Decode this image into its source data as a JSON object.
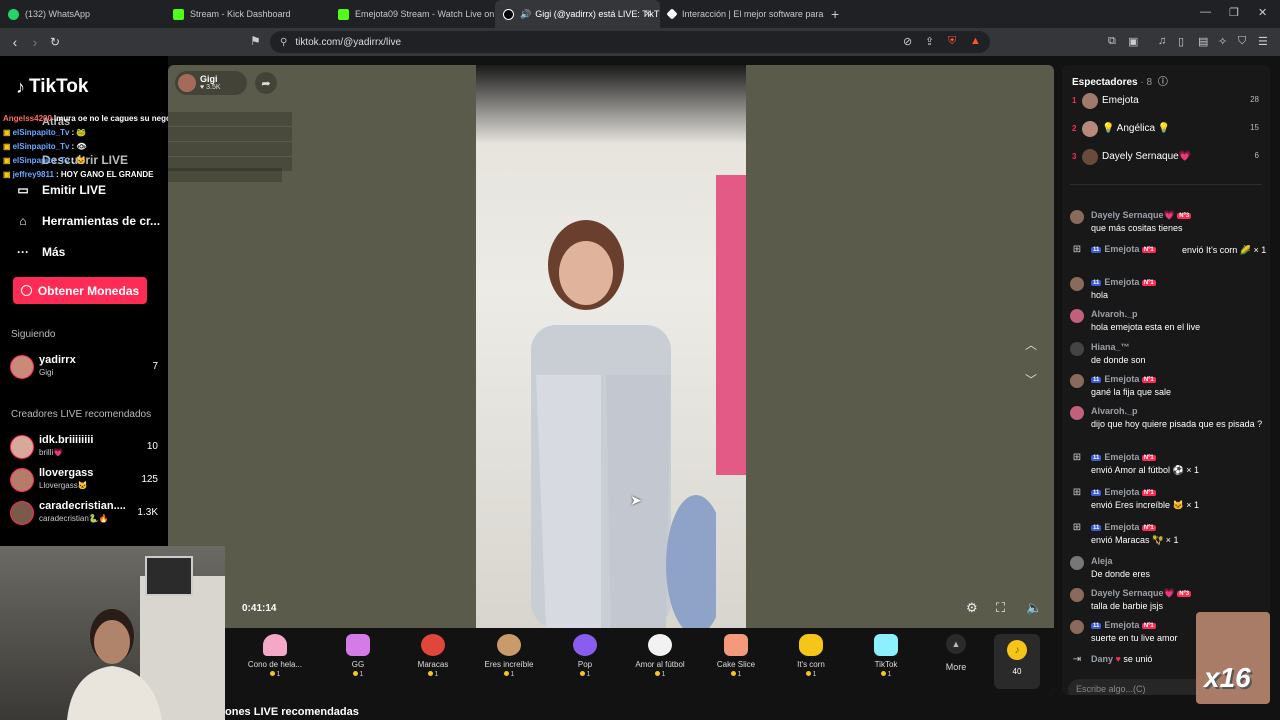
{
  "browser": {
    "tabs": [
      {
        "label": "(132) WhatsApp",
        "color": "#25d366",
        "active": false
      },
      {
        "label": "Stream - Kick Dashboard",
        "color": "#53fc18",
        "active": false
      },
      {
        "label": "Emejota09 Stream - Watch Live on Ki",
        "color": "#53fc18",
        "active": false
      },
      {
        "label": "Gigi (@yadirrx) está LIVE: TikT",
        "color": "#ffffff",
        "active": true
      },
      {
        "label": "Interacción | El mejor software para",
        "color": "#ffffff",
        "active": false
      }
    ],
    "url": "tiktok.com/@yadirrx/live"
  },
  "sidebar": {
    "logo": "TikTok",
    "nav": [
      {
        "icon": "back-icon",
        "label": "Atrás"
      },
      {
        "icon": "discover-icon",
        "label": "Descubrir LIVE"
      },
      {
        "icon": "camera-icon",
        "label": "Emitir LIVE"
      },
      {
        "icon": "home-icon",
        "label": "Herramientas de cr..."
      },
      {
        "icon": "ellipsis-icon",
        "label": "Más"
      }
    ],
    "coins_button": "Obtener Monedas",
    "following_title": "Siguiendo",
    "following": [
      {
        "name": "yadirrx",
        "sub": "Gigi",
        "count": "7"
      }
    ],
    "recommended_title": "Creadores LIVE recomendados",
    "recommended": [
      {
        "name": "idk.briiiiiiii",
        "sub": "brilli💗",
        "count": "10"
      },
      {
        "name": "llovergass",
        "sub": "Llovergass🐱",
        "count": "125"
      },
      {
        "name": "caradecristian....",
        "sub": "caradecristian🐍🔥",
        "count": "1.3K"
      }
    ]
  },
  "overlay_chat": [
    {
      "name": "Angelss4200",
      "text": "Imura oe no le cagues su negocio",
      "red": true
    },
    {
      "name": "elSinpapito_Tv",
      "text": ": 🐸",
      "red": false
    },
    {
      "name": "elSinpapito_Tv",
      "text": ": 👁",
      "red": false
    },
    {
      "name": "elSinpapito_Tv",
      "text": ": 🐱",
      "red": false
    },
    {
      "name": "jeffrey9811",
      "text": ": HOY GANO EL GRANDE",
      "red": false
    }
  ],
  "player": {
    "host_name": "Gigi",
    "host_likes": "♥ 3.5K",
    "timer": "0:41:14",
    "gifts": [
      {
        "name": "Cono de hela...",
        "price": "1",
        "color": "#f4a7c6"
      },
      {
        "name": "GG",
        "price": "1",
        "color": "#d47be8"
      },
      {
        "name": "Maracas",
        "price": "1",
        "color": "#e0463a"
      },
      {
        "name": "Eres increíble",
        "price": "1",
        "color": "#c99a6a"
      },
      {
        "name": "Pop",
        "price": "1",
        "color": "#8a5cf0"
      },
      {
        "name": "Amor al fútbol",
        "price": "1",
        "color": "#f2f2f2"
      },
      {
        "name": "Cake Slice",
        "price": "1",
        "color": "#f49a7a"
      },
      {
        "name": "It's corn",
        "price": "1",
        "color": "#f5c518"
      },
      {
        "name": "TikTok",
        "price": "1",
        "color": "#8cf0ff"
      }
    ],
    "more_label": "More",
    "coin_count": "40"
  },
  "bottom_title": "ones LIVE recomendadas",
  "right_chat": {
    "viewers_title": "Espectadores",
    "viewers_count": "· 8",
    "ranking": [
      {
        "rank": "1",
        "name": "Emejota",
        "score": "28"
      },
      {
        "rank": "2",
        "name": "💡 Angélica 💡",
        "score": "15"
      },
      {
        "rank": "3",
        "name": "Dayely Sernaque💗",
        "score": "6"
      }
    ],
    "messages": [
      {
        "name": "Dayely Sernaque💗",
        "badge": "Nº3",
        "text": "que más cositas tienes",
        "gift": false
      },
      {
        "name": "Emejota",
        "badge": "Nº1",
        "text": "envió It's corn 🌽 × 1",
        "gift": true
      },
      {
        "name": "Emejota",
        "badge": "Nº1",
        "text": "hola",
        "gift": false
      },
      {
        "name": "Alvaroh._p",
        "badge": "",
        "text": "hola emejota esta en el live",
        "gift": false
      },
      {
        "name": "Hiana_™",
        "badge": "",
        "text": "de donde son",
        "gift": false
      },
      {
        "name": "Emejota",
        "badge": "Nº1",
        "text": "gané la fija que sale",
        "gift": false
      },
      {
        "name": "Alvaroh._p",
        "badge": "",
        "text": "dijo que hoy quiere pisada que es pisada ?",
        "gift": false
      },
      {
        "name": "Emejota",
        "badge": "Nº1",
        "text": "envió Amor al fútbol ⚽ × 1",
        "gift": true
      },
      {
        "name": "Emejota",
        "badge": "Nº1",
        "text": "envió Eres increíble 🐱 × 1",
        "gift": true
      },
      {
        "name": "Emejota",
        "badge": "Nº1",
        "text": "envió Maracas 🪇 × 1",
        "gift": true
      },
      {
        "name": "Aleja",
        "badge": "",
        "text": "De donde eres",
        "gift": false
      },
      {
        "name": "Dayely Sernaque💗",
        "badge": "Nº3",
        "text": "talla de barbie jsjs",
        "gift": false
      },
      {
        "name": "Emejota",
        "badge": "Nº1",
        "text": "suerte en tu live amor",
        "gift": false
      },
      {
        "name": "Dany",
        "badge": "",
        "text": "se unió",
        "gift": false
      }
    ],
    "input_placeholder": "Escribe algo...(C)",
    "combo_text": "x16"
  }
}
